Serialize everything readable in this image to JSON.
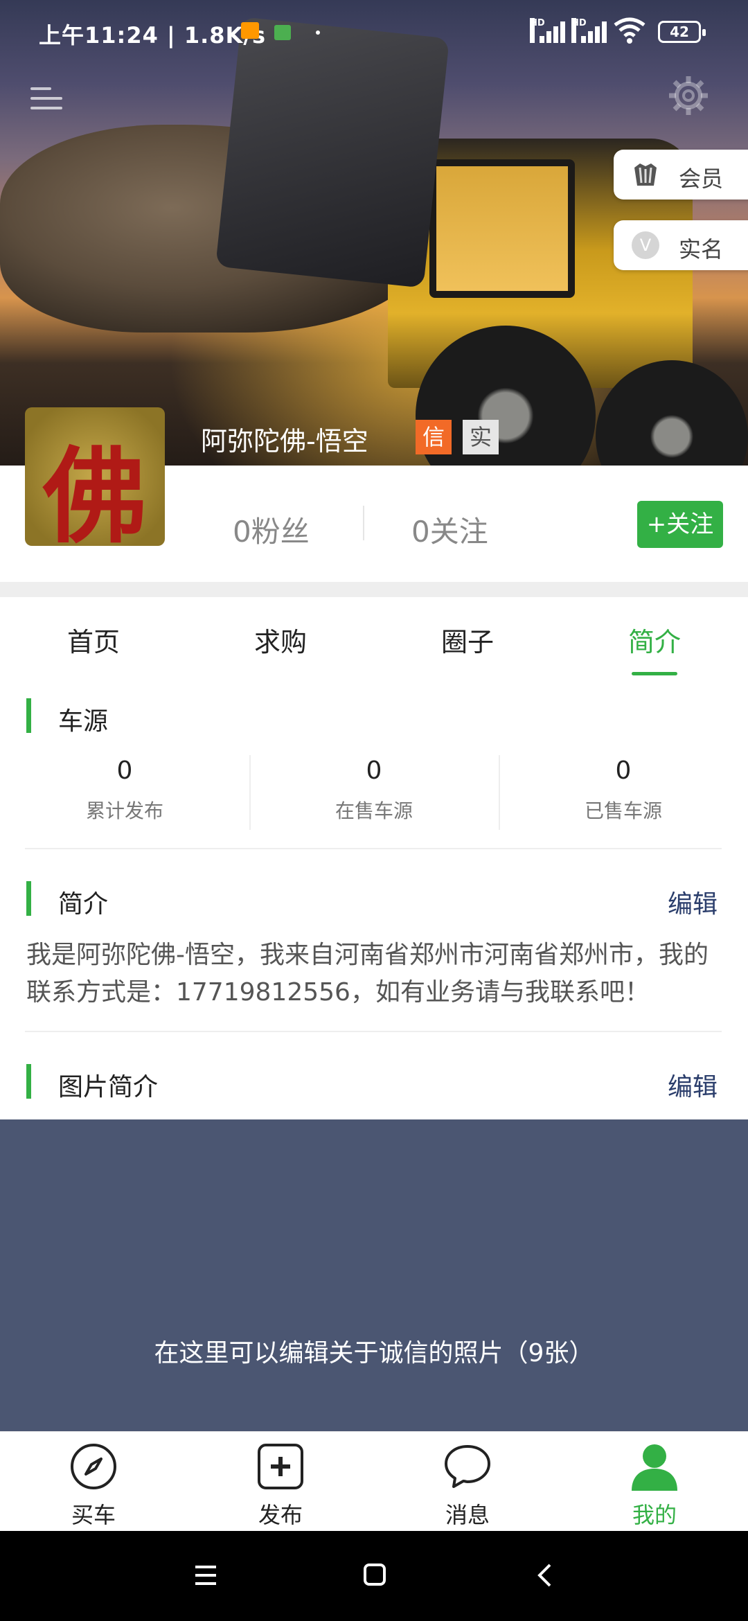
{
  "status_bar": {
    "time": "上午11:24",
    "speed": "1.8K/s",
    "network_label": "HD",
    "battery": "42"
  },
  "header": {
    "member_label": "会员",
    "realname_label": "实名",
    "realname_icon": "V"
  },
  "profile": {
    "avatar_glyph": "佛",
    "username": "阿弥陀佛-悟空",
    "badge_credit": "信",
    "badge_real": "实",
    "fans": "0粉丝",
    "follows": "0关注",
    "follow_button": "+关注"
  },
  "tabs": [
    {
      "label": "首页",
      "active": false
    },
    {
      "label": "求购",
      "active": false
    },
    {
      "label": "圈子",
      "active": false
    },
    {
      "label": "简介",
      "active": true
    }
  ],
  "vehicle_section": {
    "title": "车源",
    "stats": [
      {
        "value": "0",
        "label": "累计发布"
      },
      {
        "value": "0",
        "label": "在售车源"
      },
      {
        "value": "0",
        "label": "已售车源"
      }
    ]
  },
  "intro_section": {
    "title": "简介",
    "edit_label": "编辑",
    "text": "我是阿弥陀佛-悟空，我来自河南省郑州市河南省郑州市，我的联系方式是：17719812556，如有业务请与我联系吧！"
  },
  "photo_section": {
    "title": "图片简介",
    "edit_label": "编辑",
    "placeholder": "在这里可以编辑关于诚信的照片（9张）"
  },
  "bottom_nav": [
    {
      "label": "买车",
      "icon": "compass-icon",
      "active": false
    },
    {
      "label": "发布",
      "icon": "plus-square-icon",
      "active": false
    },
    {
      "label": "消息",
      "icon": "chat-bubble-icon",
      "active": false
    },
    {
      "label": "我的",
      "icon": "person-icon",
      "active": true
    }
  ],
  "colors": {
    "accent": "#33b045",
    "badge_credit": "#f26a27",
    "edit_link": "#2a3d6b",
    "photo_bg": "#4b5672"
  }
}
